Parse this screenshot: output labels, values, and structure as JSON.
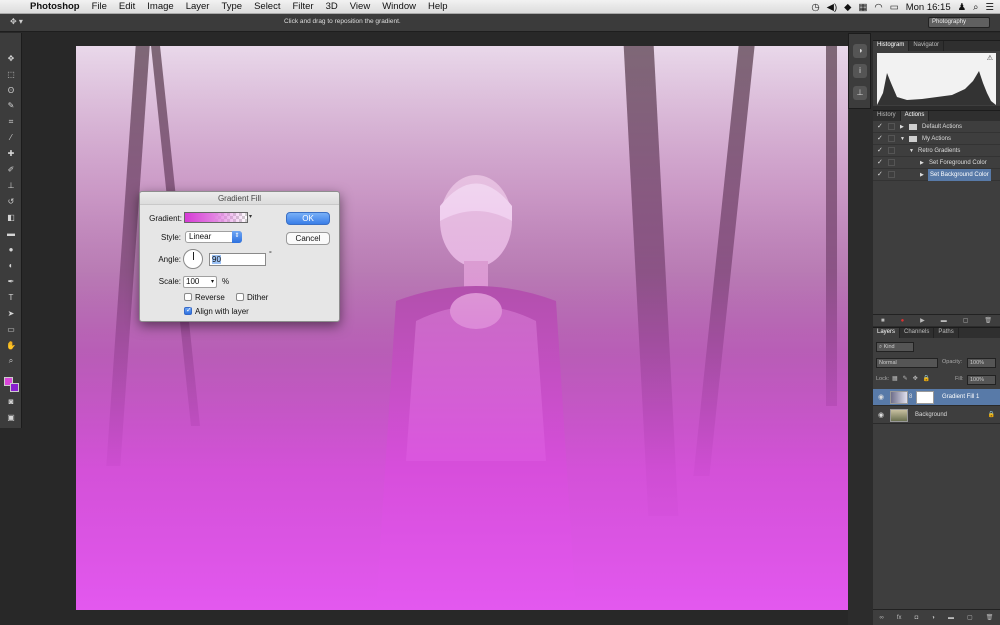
{
  "menubar": {
    "apple": "",
    "items": [
      "Photoshop",
      "File",
      "Edit",
      "Image",
      "Layer",
      "Type",
      "Select",
      "Filter",
      "3D",
      "View",
      "Window",
      "Help"
    ],
    "clock": "Mon 16:15",
    "status_icons": [
      "time-machine-icon",
      "volume-icon",
      "dropbox-icon",
      "flag-icon",
      "wifi-icon",
      "battery-icon",
      "user-icon",
      "spotlight-icon"
    ]
  },
  "optionsbar": {
    "tool_icon": "move-tool-icon",
    "hint": "Click and drag to reposition the gradient.",
    "workspace": "Photography"
  },
  "dialog": {
    "title": "Gradient Fill",
    "gradient_label": "Gradient:",
    "style_label": "Style:",
    "style_value": "Linear",
    "angle_label": "Angle:",
    "angle_value": "90",
    "degree": "°",
    "scale_label": "Scale:",
    "scale_value": "100",
    "percent": "%",
    "reverse_label": "Reverse",
    "dither_label": "Dither",
    "align_label": "Align with layer",
    "ok": "OK",
    "cancel": "Cancel",
    "reverse_checked": false,
    "dither_checked": false,
    "align_checked": true
  },
  "histogram": {
    "tabs": [
      "Histogram",
      "Navigator"
    ],
    "warning": "⚠"
  },
  "actions_panel": {
    "tabs": [
      "History",
      "Actions"
    ],
    "rows": [
      {
        "label": "Default Actions",
        "type": "set"
      },
      {
        "label": "My Actions",
        "type": "set-open"
      },
      {
        "label": "Retro Gradients",
        "type": "action-open"
      },
      {
        "label": "Set Foreground Color",
        "type": "step"
      },
      {
        "label": "Set Background Color",
        "type": "step-selected"
      }
    ]
  },
  "layers_panel": {
    "tabs": [
      "Layers",
      "Channels",
      "Paths"
    ],
    "kind": "Kind",
    "blend": "Normal",
    "opacity_label": "Opacity:",
    "opacity": "100%",
    "lock_label": "Lock:",
    "fill_label": "Fill:",
    "fill": "100%",
    "layers": [
      {
        "name": "Gradient Fill 1",
        "selected": true
      },
      {
        "name": "Background",
        "selected": false
      }
    ]
  },
  "colors": {
    "foreground": "#d946d9",
    "background": "#8a1fd0",
    "gradient_overlay": "#e358ef",
    "selection": "#587aa8"
  }
}
